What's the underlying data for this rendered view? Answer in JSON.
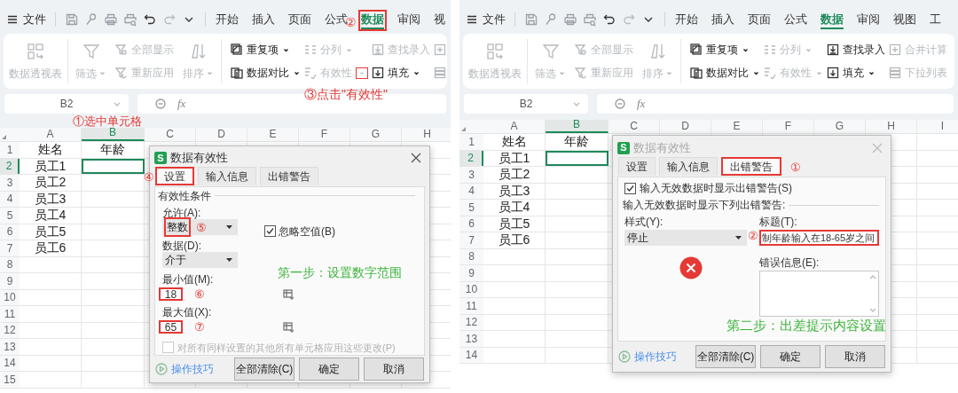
{
  "panels": [
    {
      "file_label": "文件",
      "tabs": [
        {
          "label": "开始",
          "selected": false,
          "marked": false
        },
        {
          "label": "插入",
          "selected": false,
          "marked": false
        },
        {
          "label": "页面",
          "selected": false,
          "marked": false
        },
        {
          "label": "公式",
          "selected": false,
          "marked": false
        },
        {
          "label": "数据",
          "selected": true,
          "marked": true,
          "note": "②"
        },
        {
          "label": "审阅",
          "selected": false,
          "marked": false
        },
        {
          "label": "视",
          "selected": false,
          "marked": false
        }
      ],
      "ribbon": {
        "groups": [
          {
            "columns": [
              {
                "kind": "large",
                "items": [
                  {
                    "label": "数据透视表",
                    "disabled": true,
                    "dropdown": false
                  }
                ]
              }
            ]
          },
          {
            "columns": [
              {
                "kind": "large",
                "items": [
                  {
                    "label": "筛选",
                    "disabled": true,
                    "dropdown": true
                  }
                ]
              },
              {
                "kind": "small",
                "items": [
                  {
                    "label": "全部显示",
                    "disabled": true,
                    "dropdown": false
                  },
                  {
                    "label": "重新应用",
                    "disabled": true,
                    "dropdown": false
                  }
                ]
              },
              {
                "kind": "large",
                "items": [
                  {
                    "label": "排序",
                    "disabled": true,
                    "dropdown": true
                  }
                ]
              }
            ]
          },
          {
            "columns": [
              {
                "kind": "small",
                "items": [
                  {
                    "label": "重复项",
                    "disabled": false,
                    "dropdown": true
                  },
                  {
                    "label": "数据对比",
                    "disabled": false,
                    "dropdown": true
                  }
                ]
              },
              {
                "kind": "small",
                "items": [
                  {
                    "label": "分列",
                    "disabled": true,
                    "dropdown": true
                  },
                  {
                    "label": "有效性",
                    "disabled": true,
                    "dropdown": true,
                    "marked": true,
                    "note": "③点击\"有效性\""
                  }
                ]
              },
              {
                "kind": "small",
                "items": [
                  {
                    "label": "查找录入",
                    "disabled": true,
                    "dropdown": false
                  },
                  {
                    "label": "填充",
                    "disabled": false,
                    "dropdown": true
                  }
                ]
              },
              {
                "kind": "small",
                "items": [
                  {
                    "disabled": true,
                    "dropdown": false
                  },
                  {
                    "disabled": true,
                    "dropdown": false
                  }
                ]
              }
            ]
          }
        ]
      },
      "name_box": "B2",
      "formula_label": "fx",
      "sheet": {
        "note": "①选中单元格",
        "columns": [
          {
            "label": "A",
            "selected": false
          },
          {
            "label": "B",
            "selected": true
          },
          {
            "label": "C",
            "selected": false
          },
          {
            "label": "D",
            "selected": false
          },
          {
            "label": "E",
            "selected": false
          },
          {
            "label": "F",
            "selected": false
          },
          {
            "label": "G",
            "selected": false
          },
          {
            "label": "H",
            "selected": false
          }
        ],
        "rows": [
          {
            "label": "1",
            "selected": false,
            "cells": [
              "姓名",
              "年龄"
            ]
          },
          {
            "label": "2",
            "selected": true,
            "cells": [
              "员工1"
            ]
          },
          {
            "label": "3",
            "selected": false,
            "cells": [
              "员工2"
            ]
          },
          {
            "label": "4",
            "selected": false,
            "cells": [
              "员工3"
            ]
          },
          {
            "label": "5",
            "selected": false,
            "cells": [
              "员工4"
            ]
          },
          {
            "label": "6",
            "selected": false,
            "cells": [
              "员工5"
            ]
          },
          {
            "label": "7",
            "selected": false,
            "cells": [
              "员工6"
            ]
          },
          {
            "label": "8",
            "selected": false,
            "cells": []
          },
          {
            "label": "9",
            "selected": false,
            "cells": []
          },
          {
            "label": "10",
            "selected": false,
            "cells": []
          },
          {
            "label": "11",
            "selected": false,
            "cells": []
          },
          {
            "label": "12",
            "selected": false,
            "cells": []
          },
          {
            "label": "13",
            "selected": false,
            "cells": []
          },
          {
            "label": "14",
            "selected": false,
            "cells": []
          },
          {
            "label": "15",
            "selected": false,
            "cells": []
          }
        ]
      },
      "dialog": {
        "app_icon": "S",
        "title": "数据有效性",
        "active": true,
        "tabs": [
          {
            "label": "设置",
            "selected": true,
            "marked": true,
            "note": "④"
          },
          {
            "label": "输入信息",
            "selected": false,
            "marked": false
          },
          {
            "label": "出错警告",
            "selected": false,
            "marked": false
          }
        ],
        "body": {
          "kind": "settings",
          "section": "有效性条件",
          "allow": {
            "label": "允许(A):",
            "value": "整数",
            "marked": true,
            "note": "⑤"
          },
          "ignore_blank": {
            "label": "忽略空值(B)",
            "checked": true
          },
          "data": {
            "label": "数据(D):",
            "value": "介于"
          },
          "minimum": {
            "label": "最小值(M):",
            "value": "18",
            "marked": true,
            "note": "⑥"
          },
          "maximum": {
            "label": "最大值(X):",
            "value": "65",
            "marked": true,
            "note": "⑦"
          },
          "apply_all": {
            "label": "对所有同样设置的其他所有单元格应用这些更改(P)",
            "checked": false,
            "disabled": true
          }
        },
        "step_note": "第一步：设置数字范围",
        "tips_link": "操作技巧",
        "buttons": [
          "全部清除(C)",
          "确定",
          "取消"
        ]
      }
    },
    {
      "file_label": "文件",
      "tabs": [
        {
          "label": "开始",
          "selected": false,
          "marked": false
        },
        {
          "label": "插入",
          "selected": false,
          "marked": false
        },
        {
          "label": "页面",
          "selected": false,
          "marked": false
        },
        {
          "label": "公式",
          "selected": false,
          "marked": false
        },
        {
          "label": "数据",
          "selected": true,
          "marked": false
        },
        {
          "label": "审阅",
          "selected": false,
          "marked": false
        },
        {
          "label": "视图",
          "selected": false,
          "marked": false
        },
        {
          "label": "工",
          "selected": false,
          "marked": false
        }
      ],
      "ribbon": {
        "groups": [
          {
            "columns": [
              {
                "kind": "large",
                "items": [
                  {
                    "label": "数据透视表",
                    "disabled": true,
                    "dropdown": false
                  }
                ]
              }
            ]
          },
          {
            "columns": [
              {
                "kind": "large",
                "items": [
                  {
                    "label": "筛选",
                    "disabled": true,
                    "dropdown": true
                  }
                ]
              },
              {
                "kind": "small",
                "items": [
                  {
                    "label": "全部显示",
                    "disabled": true,
                    "dropdown": false
                  },
                  {
                    "label": "重新应用",
                    "disabled": true,
                    "dropdown": false
                  }
                ]
              },
              {
                "kind": "large",
                "items": [
                  {
                    "label": "排序",
                    "disabled": true,
                    "dropdown": true
                  }
                ]
              }
            ]
          },
          {
            "columns": [
              {
                "kind": "small",
                "items": [
                  {
                    "label": "重复项",
                    "disabled": false,
                    "dropdown": true
                  },
                  {
                    "label": "数据对比",
                    "disabled": false,
                    "dropdown": true
                  }
                ]
              },
              {
                "kind": "small",
                "items": [
                  {
                    "label": "分列",
                    "disabled": true,
                    "dropdown": true
                  },
                  {
                    "label": "有效性",
                    "disabled": true,
                    "dropdown": true
                  }
                ]
              },
              {
                "kind": "small",
                "items": [
                  {
                    "label": "查找录入",
                    "disabled": false,
                    "dropdown": false
                  },
                  {
                    "label": "填充",
                    "disabled": false,
                    "dropdown": true
                  }
                ]
              },
              {
                "kind": "small",
                "items": [
                  {
                    "label": "合并计算",
                    "disabled": true,
                    "dropdown": false
                  },
                  {
                    "label": "下拉列表",
                    "disabled": true,
                    "dropdown": false
                  }
                ]
              }
            ]
          }
        ]
      },
      "name_box": "B2",
      "formula_label": "fx",
      "sheet": {
        "columns": [
          {
            "label": "A",
            "selected": false
          },
          {
            "label": "B",
            "selected": true
          },
          {
            "label": "C",
            "selected": false
          },
          {
            "label": "D",
            "selected": false
          },
          {
            "label": "E",
            "selected": false
          },
          {
            "label": "F",
            "selected": false
          },
          {
            "label": "G",
            "selected": false
          },
          {
            "label": "H",
            "selected": false
          },
          {
            "label": "I",
            "selected": false
          }
        ],
        "rows": [
          {
            "label": "1",
            "selected": false,
            "cells": [
              "姓名",
              "年龄"
            ]
          },
          {
            "label": "2",
            "selected": true,
            "cells": [
              "员工1"
            ]
          },
          {
            "label": "3",
            "selected": false,
            "cells": [
              "员工2"
            ]
          },
          {
            "label": "4",
            "selected": false,
            "cells": [
              "员工3"
            ]
          },
          {
            "label": "5",
            "selected": false,
            "cells": [
              "员工4"
            ]
          },
          {
            "label": "6",
            "selected": false,
            "cells": [
              "员工5"
            ]
          },
          {
            "label": "7",
            "selected": false,
            "cells": [
              "员工6"
            ]
          },
          {
            "label": "8",
            "selected": false,
            "cells": []
          },
          {
            "label": "9",
            "selected": false,
            "cells": []
          },
          {
            "label": "10",
            "selected": false,
            "cells": []
          },
          {
            "label": "11",
            "selected": false,
            "cells": []
          },
          {
            "label": "12",
            "selected": false,
            "cells": []
          },
          {
            "label": "13",
            "selected": false,
            "cells": []
          },
          {
            "label": "14",
            "selected": false,
            "cells": []
          }
        ]
      },
      "dialog": {
        "app_icon": "S",
        "title": "数据有效性",
        "active": false,
        "tabs": [
          {
            "label": "设置",
            "selected": false,
            "marked": false
          },
          {
            "label": "输入信息",
            "selected": false,
            "marked": false
          },
          {
            "label": "出错警告",
            "selected": true,
            "marked": true,
            "note": "①"
          }
        ],
        "body": {
          "kind": "error_alert",
          "show_alert": {
            "label": "输入无效数据时显示出错警告(S)",
            "checked": true
          },
          "section": "输入无效数据时显示下列出错警告:",
          "style": {
            "label": "样式(Y):",
            "value": "停止"
          },
          "alert_title": {
            "label": "标题(T):",
            "value": "制年龄输入在18-65岁之间",
            "marked": true,
            "note": "②"
          },
          "message": {
            "label": "错误信息(E):"
          }
        },
        "step_note": "第二步：出差提示内容设置",
        "tips_link": "操作技巧",
        "buttons": [
          "全部清除(C)",
          "确定",
          "取消"
        ]
      }
    }
  ]
}
